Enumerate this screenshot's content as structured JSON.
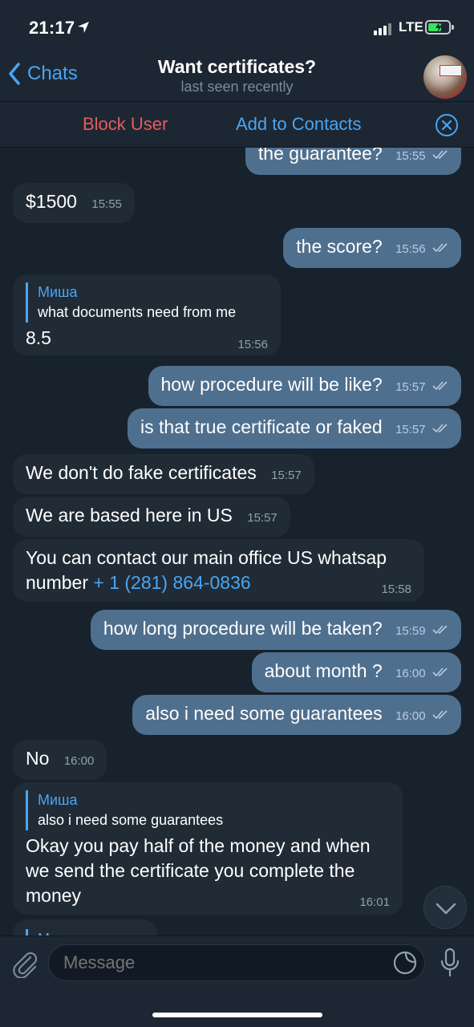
{
  "status_bar": {
    "time": "21:17",
    "network": "LTE"
  },
  "header": {
    "back_label": "Chats",
    "title": "Want certificates?",
    "subtitle": "last seen recently"
  },
  "actions": {
    "block": "Block User",
    "add": "Add to Contacts"
  },
  "messages": [
    {
      "dir": "out",
      "text": "the guarantee?",
      "time": "15:55"
    },
    {
      "dir": "in",
      "text": "$1500",
      "time": "15:55"
    },
    {
      "dir": "out",
      "text": "the score?",
      "time": "15:56"
    },
    {
      "dir": "in",
      "reply_name": "Миша",
      "reply_text": "what documents need from me",
      "text": "8.5",
      "time": "15:56"
    },
    {
      "dir": "out",
      "text": "how procedure will be like?",
      "time": "15:57"
    },
    {
      "dir": "out",
      "text": "is that true certificate or faked",
      "time": "15:57"
    },
    {
      "dir": "in",
      "text": "We don't do fake certificates",
      "time": "15:57"
    },
    {
      "dir": "in",
      "text": "We are based here in US",
      "time": "15:57"
    },
    {
      "dir": "in",
      "text_line1": "You can contact our main office US whatsap",
      "text_line2_prefix": "number",
      "phone": "+ 1 (281) 864-0836",
      "time": "15:58"
    },
    {
      "dir": "out",
      "text": "how long procedure will be taken?",
      "time": "15:59"
    },
    {
      "dir": "out",
      "text": "about month ?",
      "time": "16:00"
    },
    {
      "dir": "out",
      "text": "also i need some guarantees",
      "time": "16:00"
    },
    {
      "dir": "in",
      "text": "No",
      "time": "16:00"
    },
    {
      "dir": "in",
      "reply_name": "Миша",
      "reply_text": "also i need some guarantees",
      "text_lines": [
        "Okay you pay half of the money and when",
        "we send the certificate you complete the",
        "money"
      ],
      "time": "16:01"
    },
    {
      "dir": "in",
      "reply_name": "Миша"
    }
  ],
  "composer": {
    "placeholder": "Message"
  },
  "colors": {
    "background": "#18222d",
    "bar": "#1d2733",
    "incoming_bubble": "#202b36",
    "outgoing_bubble": "#4f6f8e",
    "accent": "#4aa5f3",
    "danger": "#e55c5c"
  }
}
